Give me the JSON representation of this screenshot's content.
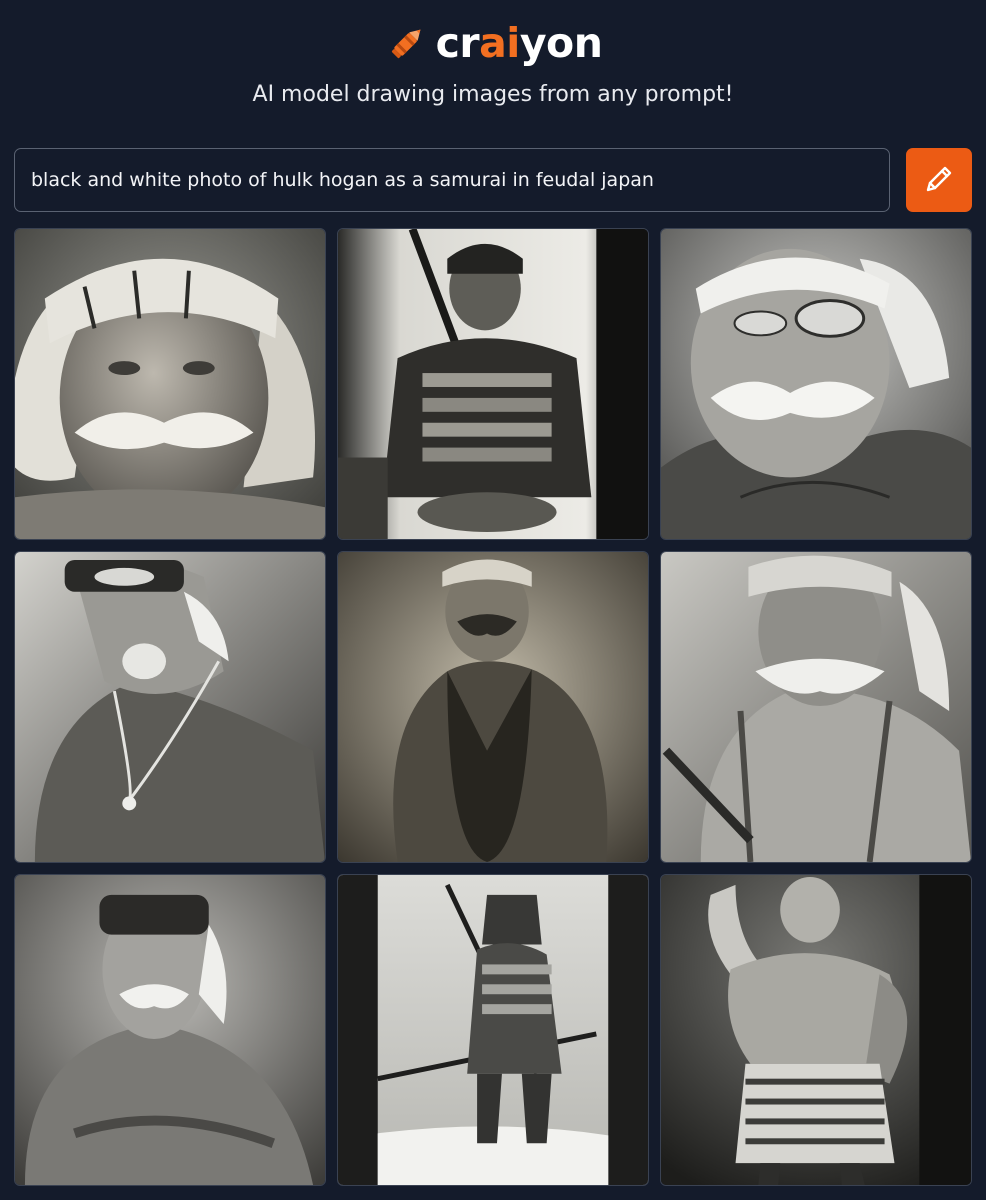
{
  "brand": {
    "name_prefix": "cr",
    "name_accent": "ai",
    "name_suffix": "yon",
    "icon": "crayon-icon",
    "accent_color": "#f26f21"
  },
  "tagline": "AI model drawing images from any prompt!",
  "search": {
    "value": "black and white photo of hulk hogan as a samurai in feudal japan",
    "button_icon": "pencil-icon",
    "button_color": "#ec5b14"
  },
  "results": {
    "count": 9,
    "items": [
      {
        "subject": "bearded wrestler with bandana, close-up portrait",
        "icon": "generated-image"
      },
      {
        "subject": "samurai in armor figure",
        "icon": "generated-image"
      },
      {
        "subject": "mustached wrestler with bandana, close-up",
        "icon": "generated-image"
      },
      {
        "subject": "wrestler with bandana and necklace",
        "icon": "generated-image"
      },
      {
        "subject": "muscular wrestler in tank top",
        "icon": "generated-image"
      },
      {
        "subject": "wrestler with bandana holding sword",
        "icon": "generated-image"
      },
      {
        "subject": "wrestler with bandana, arms crossed",
        "icon": "generated-image"
      },
      {
        "subject": "samurai in armor with katana",
        "icon": "generated-image"
      },
      {
        "subject": "muscular figure with raised arm in samurai skirt",
        "icon": "generated-image"
      }
    ]
  }
}
